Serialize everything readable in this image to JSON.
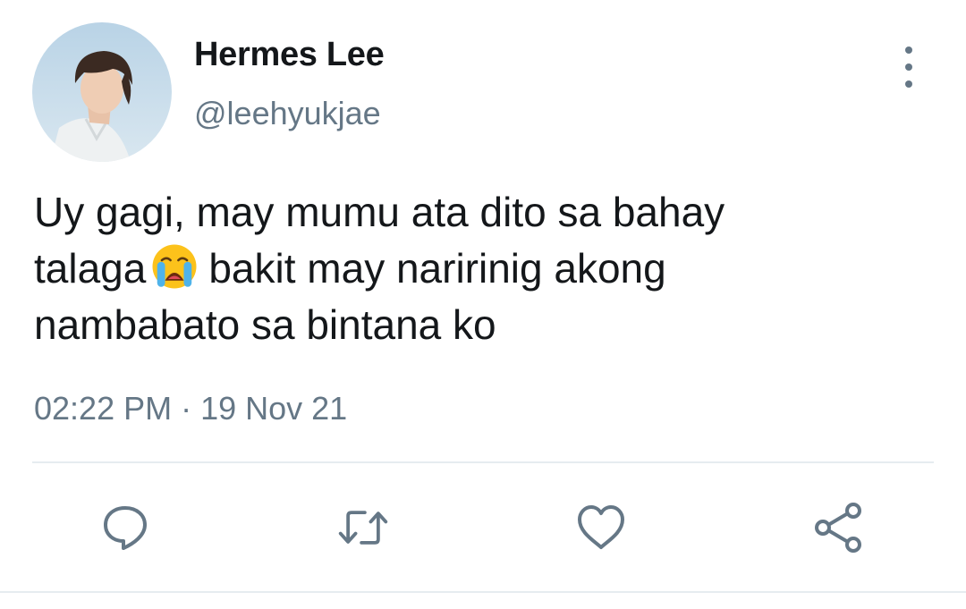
{
  "user": {
    "display_name": "Hermes Lee",
    "handle": "@leehyukjae"
  },
  "tweet": {
    "line1": "Uy gagi, may mumu ata dito sa bahay",
    "line2_before_emoji": "talaga",
    "emoji": "loudly-crying-face",
    "line2_after_emoji": "bakit may naririnig akong",
    "line3": "nambabato sa bintana ko"
  },
  "meta": {
    "time": "02:22 PM",
    "separator": "·",
    "date": "19 Nov 21"
  },
  "actions": [
    "reply-icon",
    "retweet-icon",
    "like-icon",
    "share-icon"
  ],
  "colors": {
    "text": "#14171a",
    "secondary": "#657786",
    "divider": "#e6ecf0"
  }
}
